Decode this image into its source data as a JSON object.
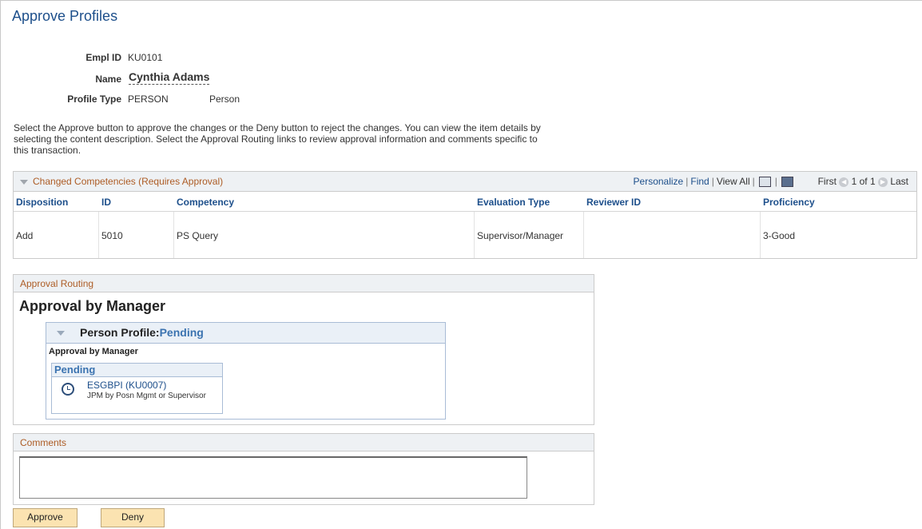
{
  "page": {
    "title": "Approve Profiles"
  },
  "header": {
    "emplid_label": "Empl ID",
    "emplid_value": "KU0101",
    "name_label": "Name",
    "name_value": "Cynthia Adams",
    "profile_type_label": "Profile Type",
    "profile_type_code": "PERSON",
    "profile_type_desc": "Person"
  },
  "instructions": "Select the Approve button to approve the changes or the Deny button to reject the changes. You can view the item details by selecting the content description. Select the Approval Routing links to review approval information and comments specific to this transaction.",
  "grid": {
    "title": "Changed Competencies (Requires Approval)",
    "nav": {
      "personalize": "Personalize",
      "find": "Find",
      "view_all": "View All",
      "first": "First",
      "range": "1 of 1",
      "last": "Last"
    },
    "columns": [
      "Disposition",
      "ID",
      "Competency",
      "Evaluation Type",
      "Reviewer ID",
      "Proficiency"
    ],
    "rows": [
      {
        "disposition": "Add",
        "id": "5010",
        "competency": "PS Query",
        "evaluation_type": "Supervisor/Manager",
        "reviewer_id": "",
        "proficiency": "3-Good"
      }
    ]
  },
  "approval_routing": {
    "section_title": "Approval Routing",
    "heading": "Approval by Manager",
    "profile_label": "Person Profile:",
    "profile_status": "Pending",
    "stage_label": "Approval by Manager",
    "pending_label": "Pending",
    "approver_link": "ESGBPI (KU0007)",
    "approver_desc": "JPM by Posn Mgmt or Supervisor"
  },
  "comments": {
    "section_title": "Comments",
    "value": ""
  },
  "buttons": {
    "approve": "Approve",
    "deny": "Deny"
  },
  "colors": {
    "link": "#1d4f8b",
    "section_title": "#ad5c25",
    "button_bg": "#fbe3b1"
  }
}
